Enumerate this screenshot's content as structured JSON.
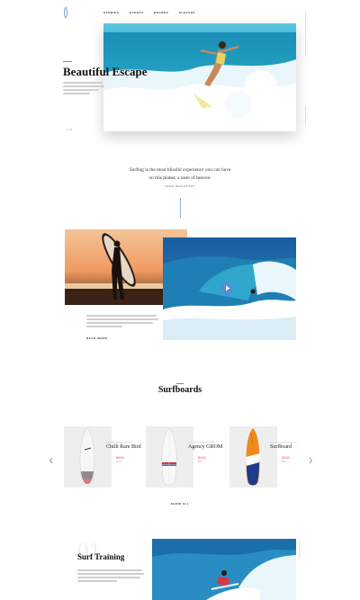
{
  "nav": {
    "items": [
      {
        "label": "STORIES"
      },
      {
        "label": "EVENTS"
      },
      {
        "label": "BOARDS"
      },
      {
        "label": "SLEEVES"
      }
    ]
  },
  "hero": {
    "title": "Beautiful Escape",
    "pager": "1 / 3"
  },
  "quote": {
    "text_line1": "Surfing is the most blissful experience you can have",
    "text_line2": "on this planet, a taste of heaven.",
    "author": "JOHN MCCARTHY"
  },
  "story": {
    "read_more": "READ MORE"
  },
  "surfboards": {
    "title": "Surfboards",
    "show_all": "SHOW ALL",
    "items": [
      {
        "name": "Chilli Rare Bird",
        "price": "$650",
        "price_sub": "BUY"
      },
      {
        "name": "Agency GROM",
        "price": "$450",
        "price_sub": "BUY"
      },
      {
        "name": "Surfboard",
        "price": "$100",
        "price_sub": "BUY"
      }
    ]
  },
  "training": {
    "number": "01",
    "title": "Surf Training"
  },
  "colors": {
    "accent": "#e8507a",
    "ocean": "#1f7fb5",
    "play": "#4f8fd8"
  }
}
